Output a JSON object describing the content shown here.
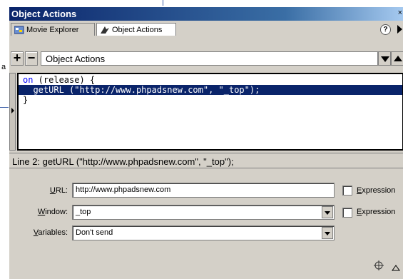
{
  "window": {
    "title": "Object Actions",
    "close_glyph": "×"
  },
  "tabs": [
    {
      "label": "Movie Explorer",
      "icon": "movie-explorer-icon",
      "active": false
    },
    {
      "label": "Object Actions",
      "icon": "actions-arrow-icon",
      "active": true
    }
  ],
  "toolbar": {
    "add_label": "+",
    "remove_label": "−",
    "title": "Object Actions"
  },
  "code": {
    "lines": [
      {
        "kw": "on",
        "rest": " (release) {"
      },
      {
        "kw": "",
        "rest": "  getURL (\"http://www.phpadsnew.com\", \"_top\");"
      },
      {
        "kw": "",
        "rest": "}"
      }
    ]
  },
  "status": {
    "text": "Line 2: getURL (\"http://www.phpadsnew.com\", \"_top\");"
  },
  "params": {
    "url": {
      "label_first": "U",
      "label_rest": "RL:",
      "value": "http://www.phpadsnew.com"
    },
    "window": {
      "label_first": "W",
      "label_rest": "indow:",
      "value": "_top"
    },
    "variables": {
      "label_first": "V",
      "label_rest": "ariables:",
      "value": "Don't send"
    },
    "expression_first": "E",
    "expression_rest": "xpression"
  },
  "background": {
    "letter": "a"
  },
  "help_label": "?"
}
